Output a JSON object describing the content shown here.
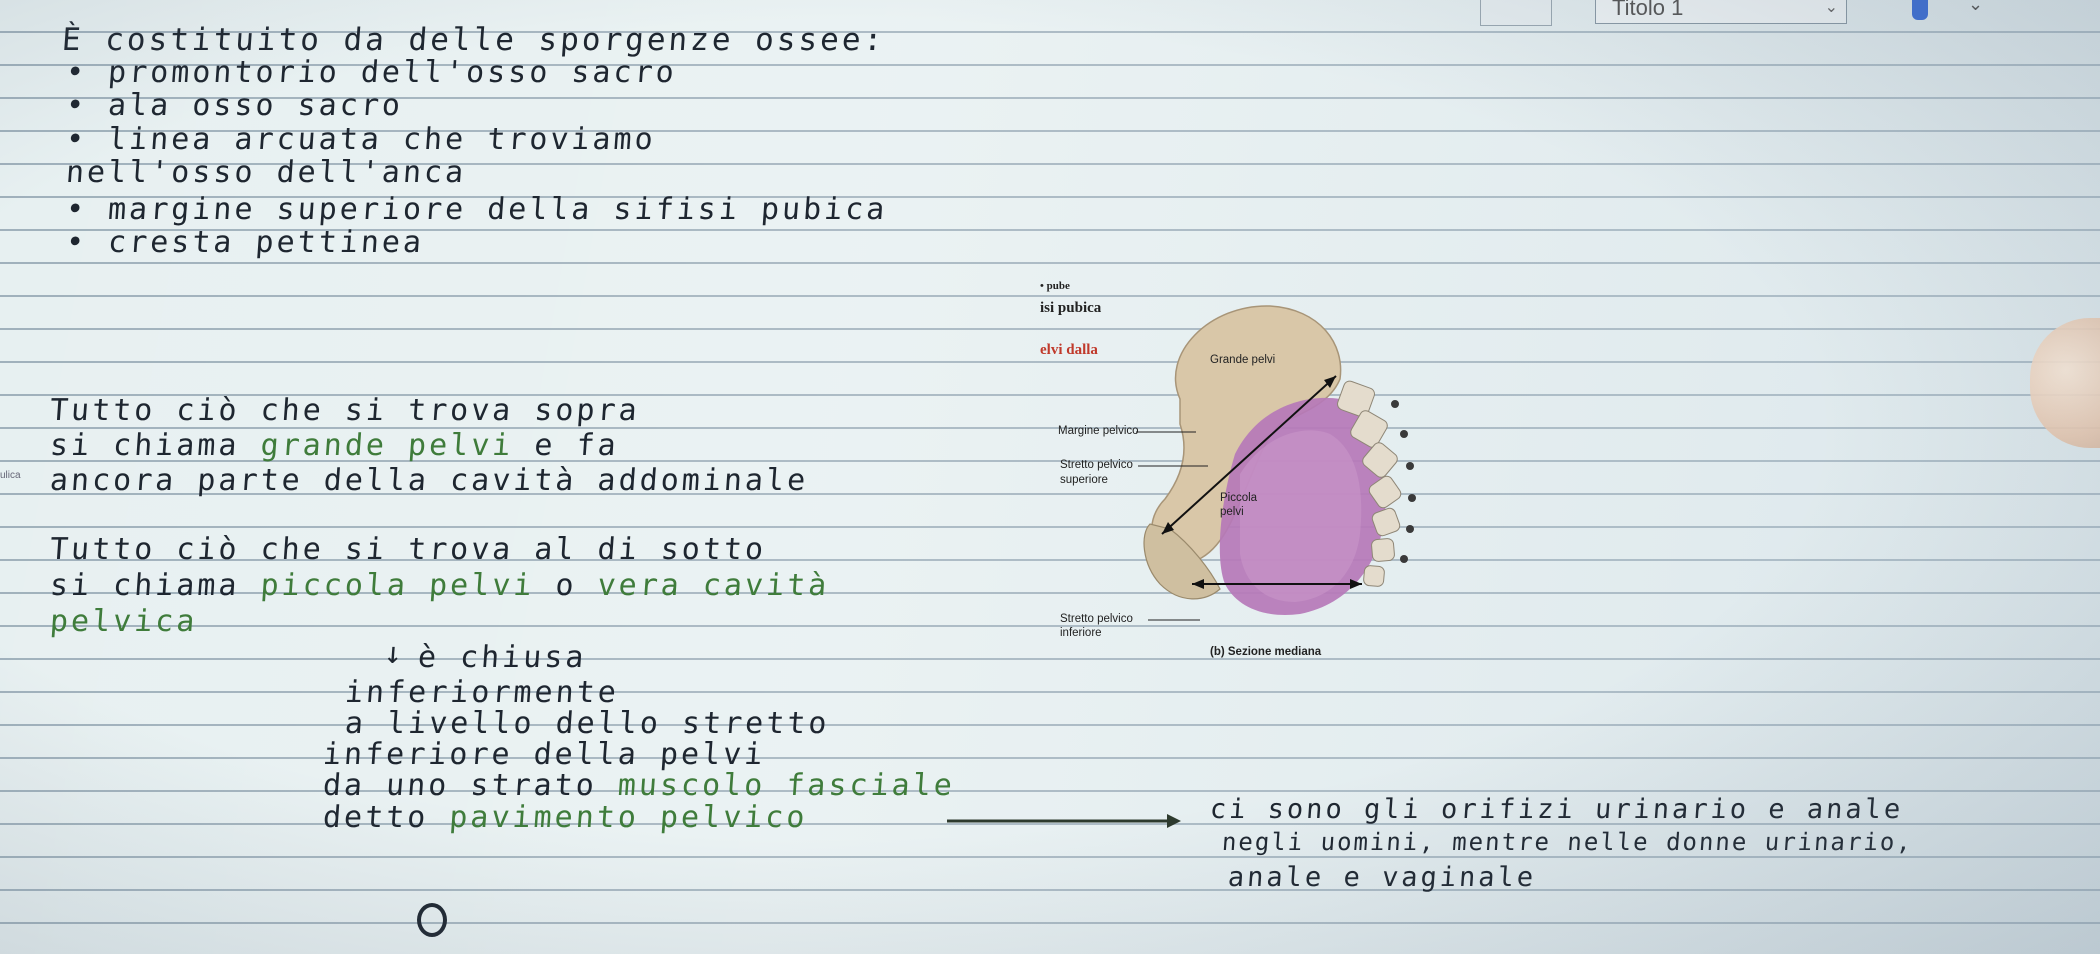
{
  "toolbar": {
    "style_select": {
      "value": "Titolo 1"
    },
    "icons": [
      "pen-icon",
      "chevron-down-icon"
    ]
  },
  "notes": {
    "block1": {
      "line1": "È costituito da delle sporgenze ossee:",
      "line2": "• promontorio dell'osso sacro",
      "line3": "• ala osso sacro",
      "line4": "• linea arcuata che troviamo",
      "line5": "nell'osso dell'anca",
      "line6": "• margine superiore della sifisi pubica",
      "line7": "• cresta pettinea"
    },
    "block2": {
      "line1": "Tutto ciò che si trova sopra",
      "line2_a": "si chiama ",
      "line2_b": "grande pelvi",
      "line2_c": " e fa",
      "line3": "ancora parte della cavità addominale"
    },
    "block3": {
      "line1": "Tutto ciò che si trova al di sotto",
      "line2_a": "si chiama ",
      "line2_b": "piccola pelvi",
      "line2_c": " o ",
      "line2_d": "vera cavità",
      "line3": "pelvica"
    },
    "block4": {
      "arrow": "↓",
      "line1": "è chiusa",
      "line2": "inferiormente",
      "line3": "a livello dello stretto",
      "line4": "inferiore della pelvi",
      "line5_a": "da uno strato ",
      "line5_b": "muscolo fasciale",
      "line6_a": "detto ",
      "line6_b": "pavimento pelvico"
    },
    "block5": {
      "line1": "ci sono gli orifizi urinario e anale",
      "line2": "negli uomini, mentre nelle donne urinario,",
      "line3": "anale e vaginale"
    }
  },
  "figure": {
    "frag_top": "• pube",
    "frag_sinfisi": "isi pubica",
    "frag_pelvi": "elvi dalla",
    "label_grande": "Grande pelvi",
    "label_margine": "Margine pelvico",
    "label_superiore_1": "Stretto pelvico",
    "label_superiore_2": "superiore",
    "label_piccola_1": "Piccola",
    "label_piccola_2": "pelvi",
    "label_inferiore_1": "Stretto pelvico",
    "label_inferiore_2": "inferiore",
    "caption": "(b) Sezione mediana"
  },
  "side": {
    "stub": "ulica"
  },
  "colors": {
    "ink": "#1e2630",
    "green_ink": "#3f7c3b",
    "bone": "#d9c7a8",
    "cavity": "#b678b8"
  }
}
